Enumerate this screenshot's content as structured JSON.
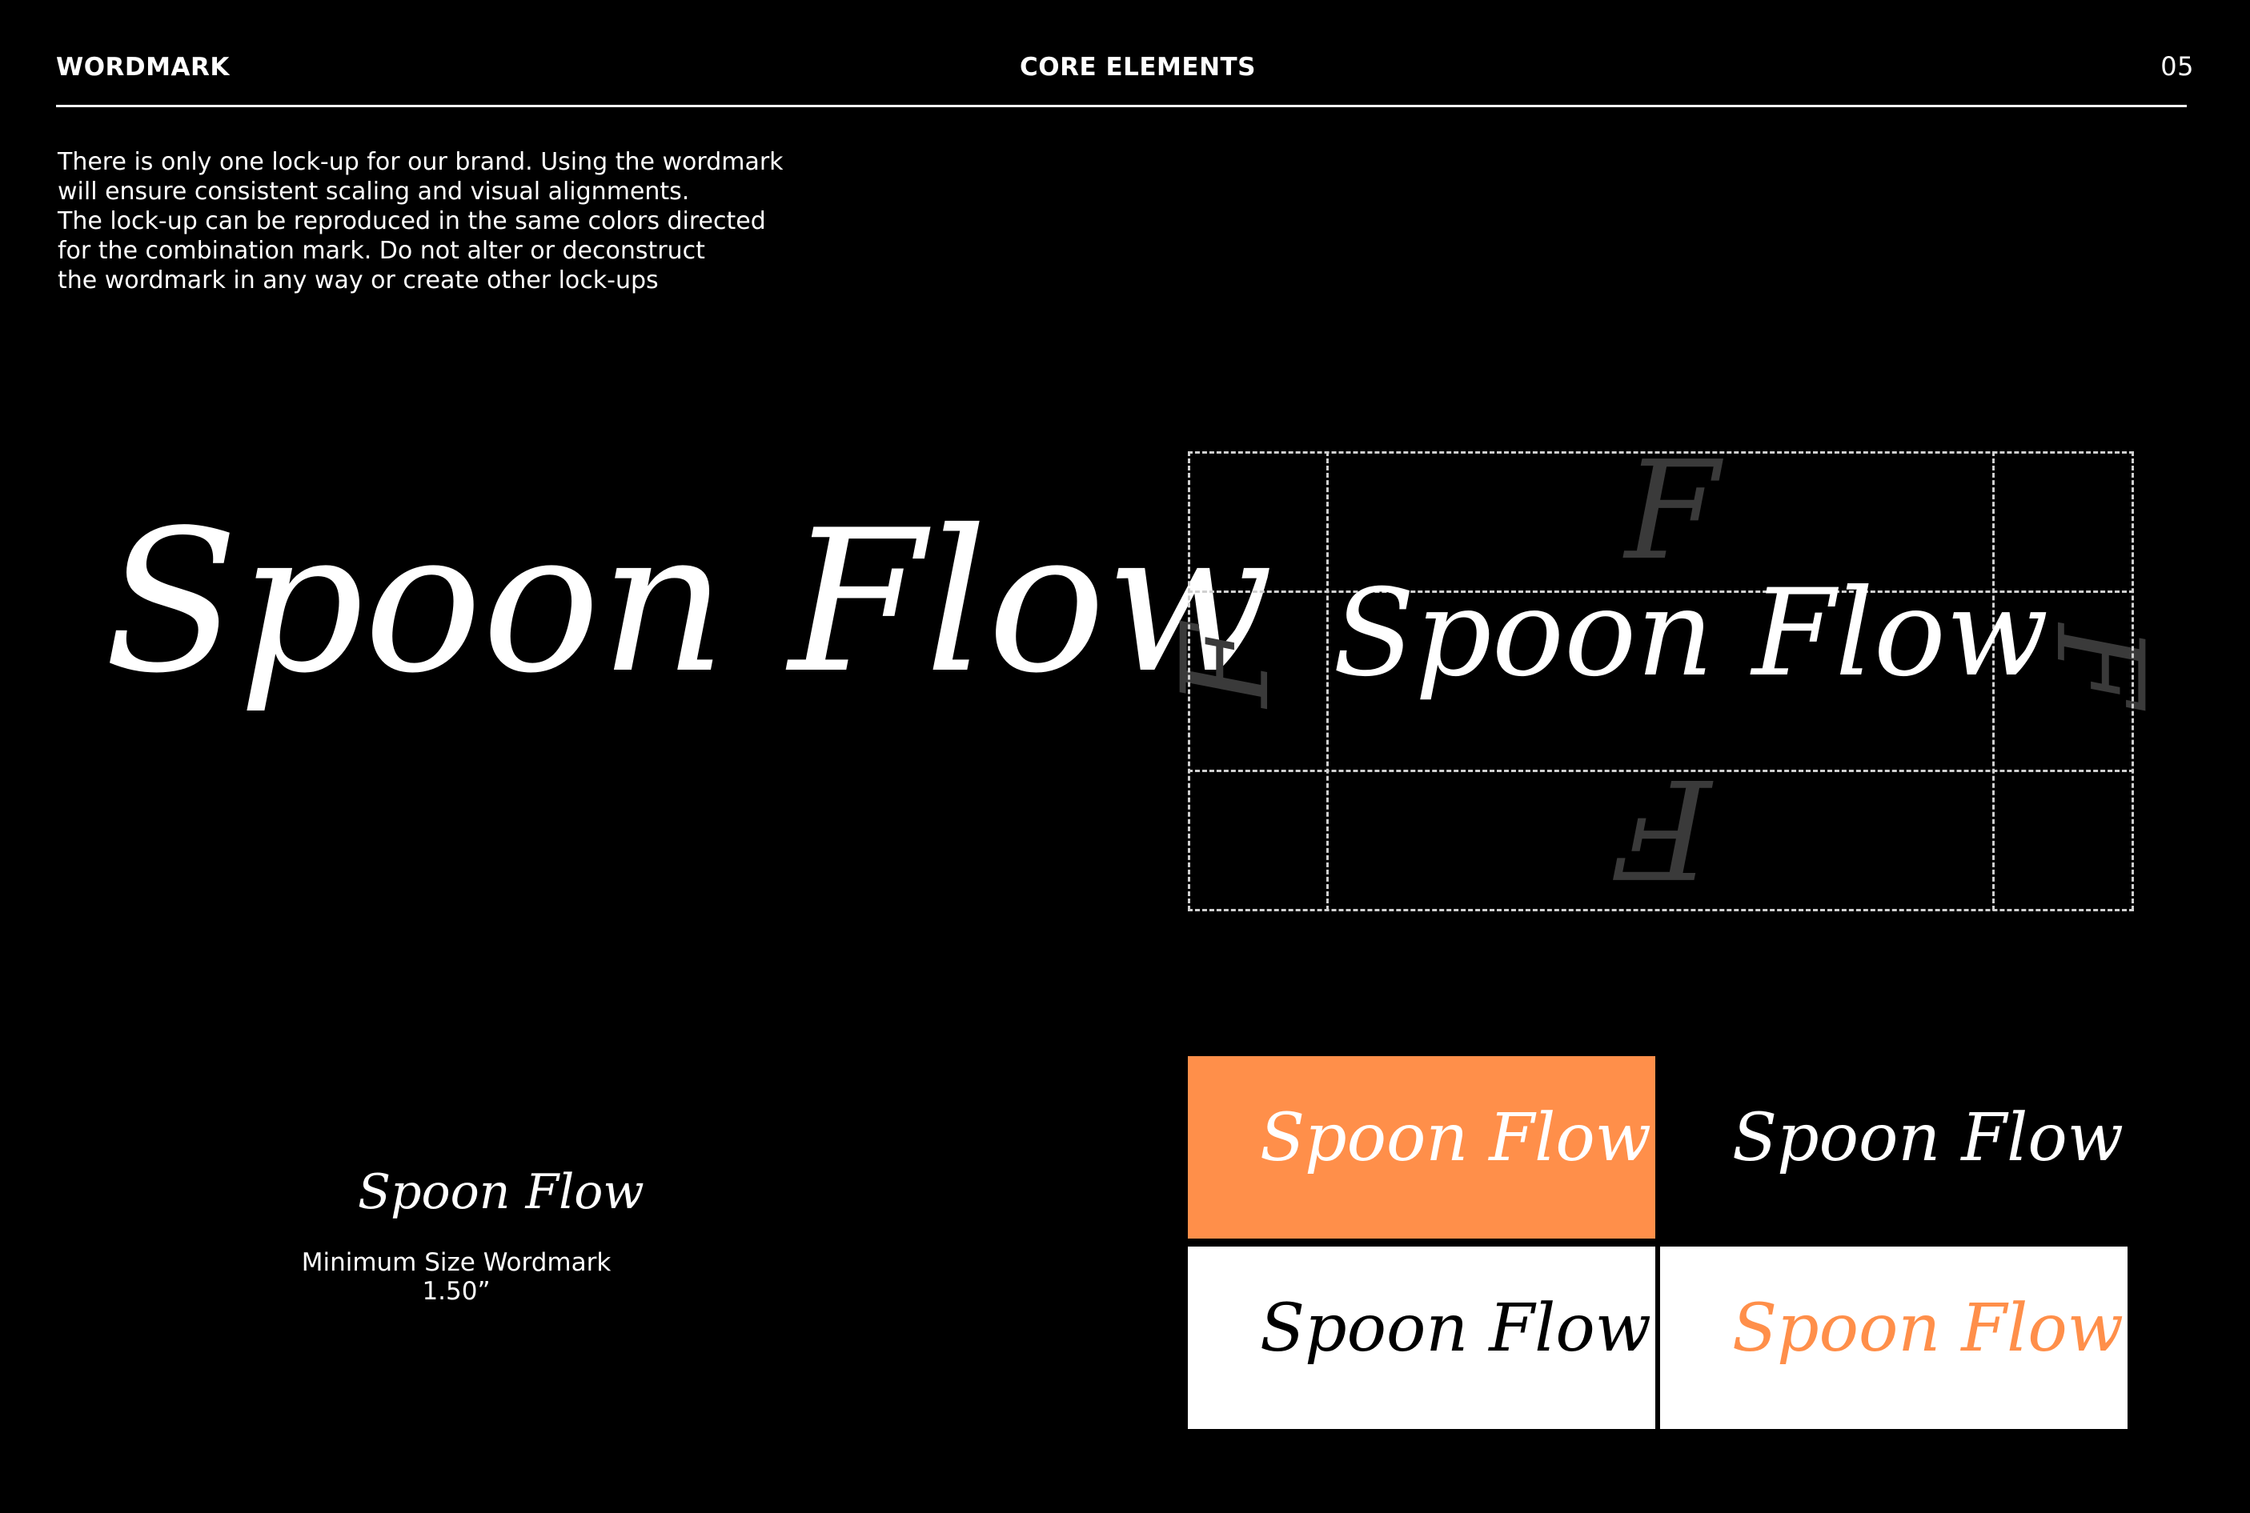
{
  "header": {
    "section": "WORDMARK",
    "chapter": "CORE ELEMENTS",
    "page_number": "05"
  },
  "intro_lines": [
    "There is only one lock-up for our brand. Using the wordmark",
    "will ensure consistent scaling and visual alignments.",
    "The lock-up can be reproduced in the same colors directed",
    "for the combination mark. Do not alter or deconstruct",
    "the wordmark in any way or create other lock-ups"
  ],
  "wordmark": "Spoon Flow",
  "clearspace_glyph": "F",
  "minimum_size": {
    "label": "Minimum Size Wordmark",
    "value": "1.50”"
  },
  "variants": [
    {
      "background": "#ff8f4a",
      "text_color": "#ffffff"
    },
    {
      "background": "#000000",
      "text_color": "#ffffff"
    },
    {
      "background": "#ffffff",
      "text_color": "#000000"
    },
    {
      "background": "#ffffff",
      "text_color": "#ff8f4a"
    }
  ]
}
